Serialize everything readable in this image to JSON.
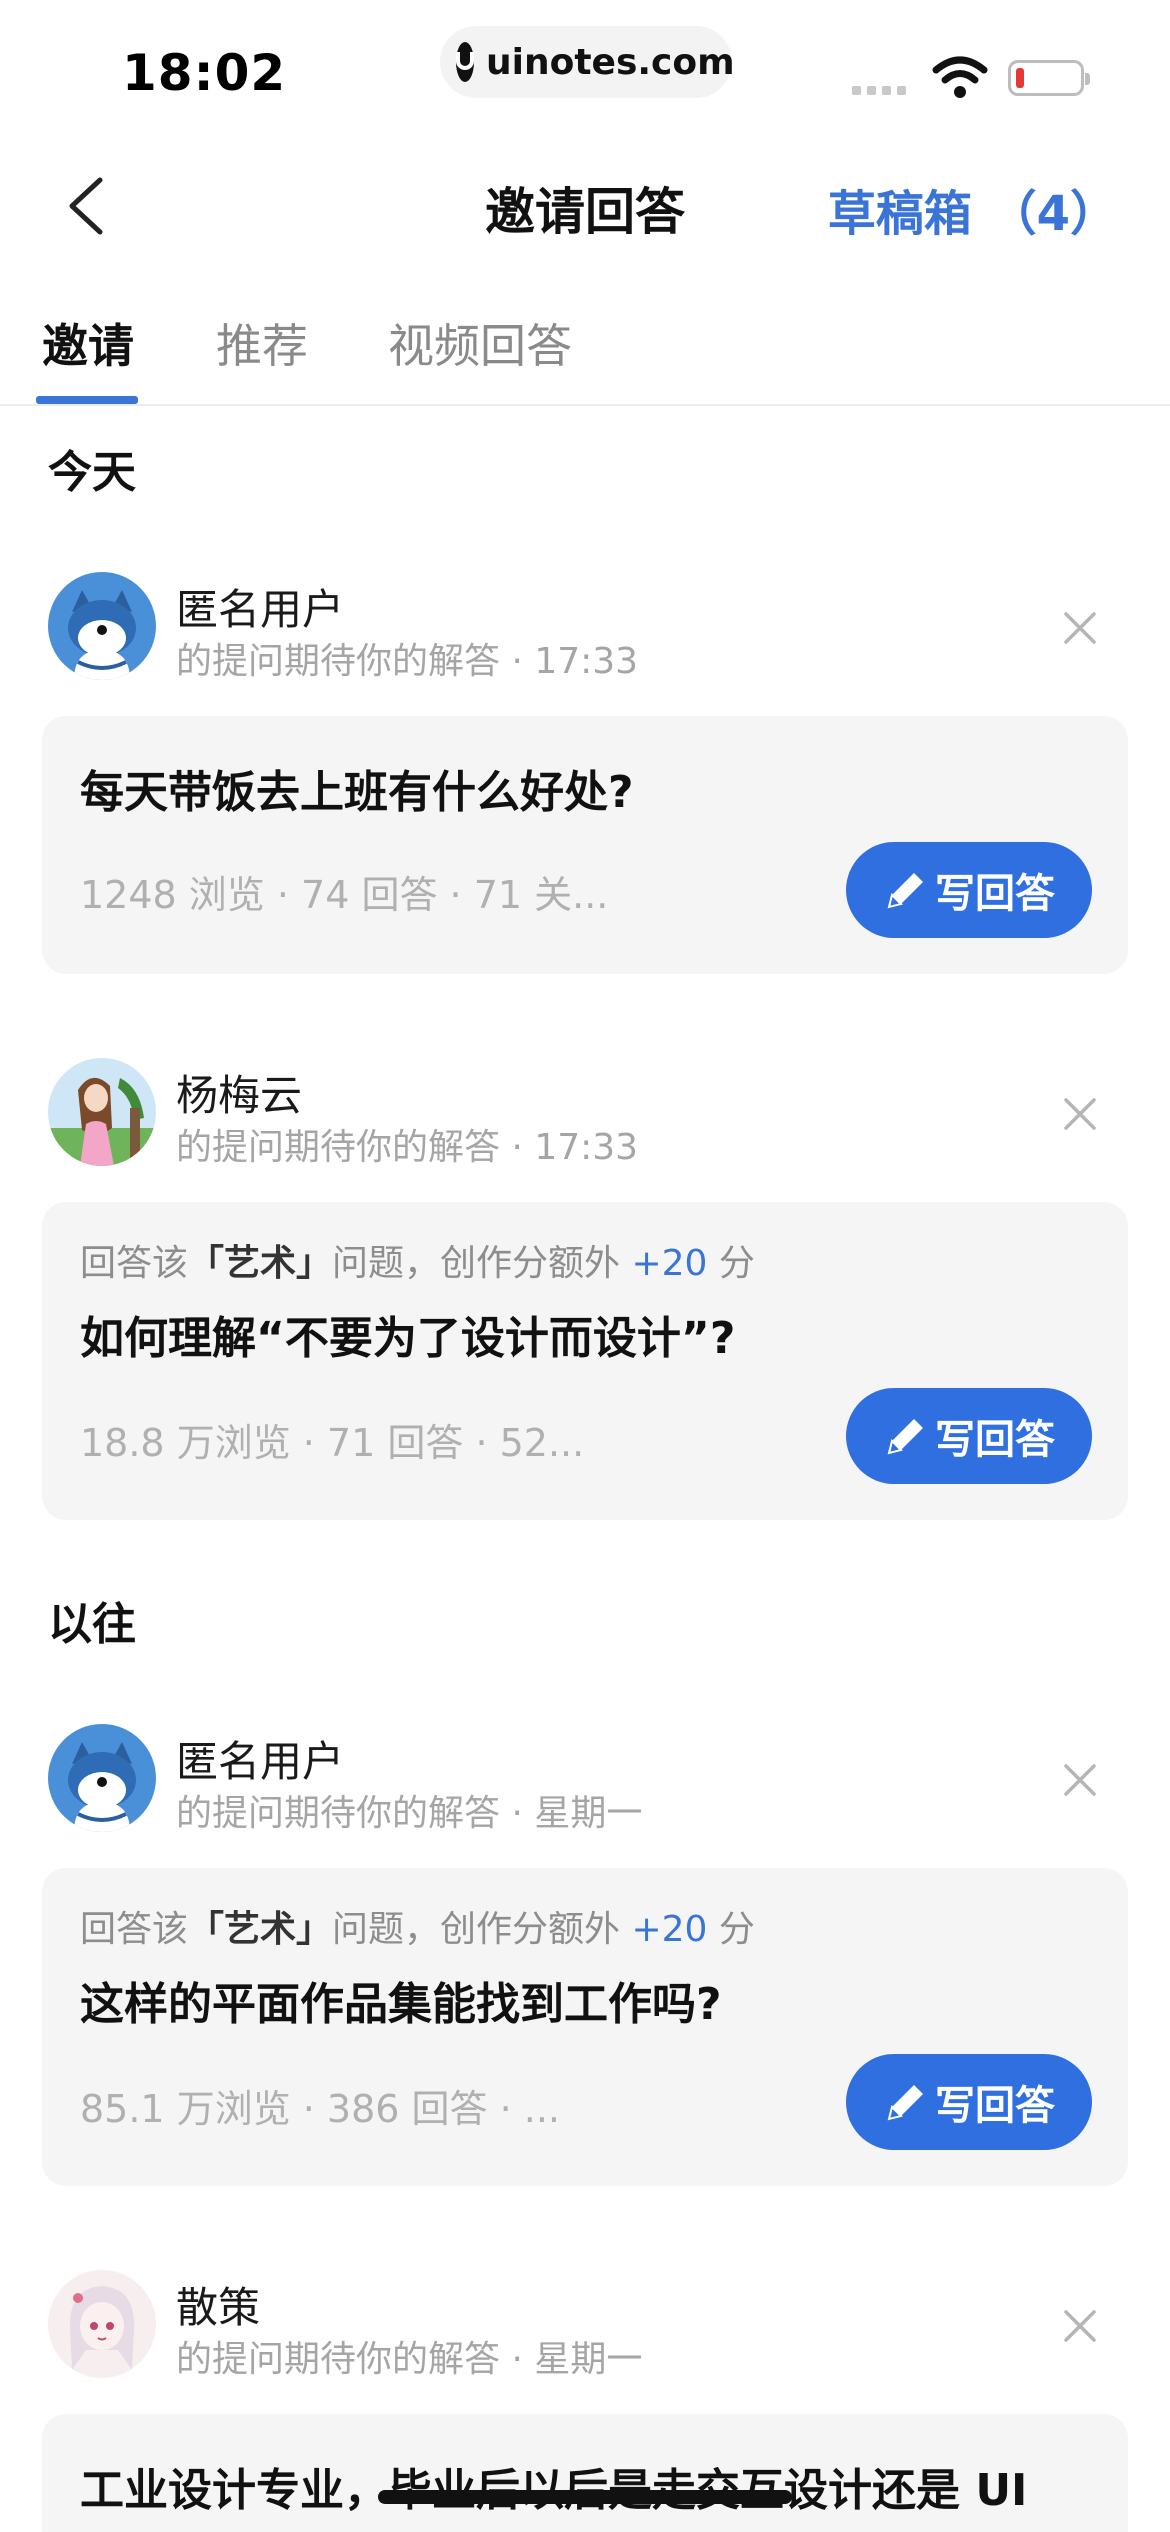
{
  "status_bar": {
    "time": "18:02",
    "url": "uinotes.com"
  },
  "nav": {
    "title": "邀请回答",
    "drafts": "草稿箱 （4）"
  },
  "tabs": [
    {
      "label": "邀请"
    },
    {
      "label": "推荐"
    },
    {
      "label": "视频回答"
    }
  ],
  "sections": {
    "today": "今天",
    "past": "以往"
  },
  "items": [
    {
      "user": "匿名用户",
      "subtitle": "的提问期待你的解答 · 17:33",
      "question": "每天带饭去上班有什么好处?",
      "stats": "1248 浏览 · 74 回答 · 71 关...",
      "button": "写回答"
    },
    {
      "user": "杨梅云",
      "subtitle": "的提问期待你的解答 · 17:33",
      "hint_pre": "回答该",
      "hint_topic": "「艺术」",
      "hint_mid": "问题，创作分额外 ",
      "hint_plus": "+20",
      "hint_post": " 分",
      "question": "如何理解“不要为了设计而设计”?",
      "stats": "18.8 万浏览 · 71 回答 · 52...",
      "button": "写回答"
    },
    {
      "user": "匿名用户",
      "subtitle": "的提问期待你的解答 · 星期一",
      "hint_pre": "回答该",
      "hint_topic": "「艺术」",
      "hint_mid": "问题，创作分额外 ",
      "hint_plus": "+20",
      "hint_post": " 分",
      "question": "这样的平面作品集能找到工作吗?",
      "stats": "85.1 万浏览 · 386 回答 · ...",
      "button": "写回答"
    },
    {
      "user": "散策",
      "subtitle": "的提问期待你的解答 · 星期一",
      "question": "工业设计专业，毕业后以后是走交互设计还是 UI"
    }
  ],
  "colors": {
    "accent": "#2f6fe0",
    "card_bg": "#f5f5f5"
  }
}
